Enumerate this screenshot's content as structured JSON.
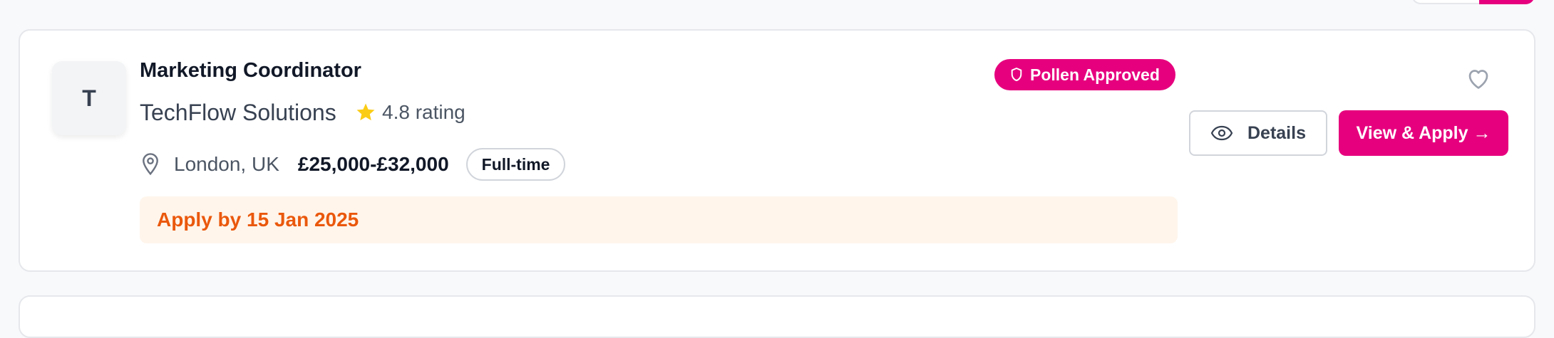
{
  "job": {
    "logo_letter": "T",
    "title": "Marketing Coordinator",
    "company": "TechFlow Solutions",
    "rating": "4.8 rating",
    "location": "London, UK",
    "salary": "£25,000-£32,000",
    "employment_type": "Full-time",
    "deadline": "Apply by 15 Jan 2025",
    "badge": "Pollen Approved"
  },
  "actions": {
    "details_label": "Details",
    "apply_label": "View & Apply →"
  },
  "icons": {
    "star": "star-icon",
    "location": "map-pin-icon",
    "badge": "shield-icon",
    "favorite": "heart-icon",
    "details": "eye-icon"
  },
  "colors": {
    "brand": "#e6007e",
    "star": "#facc15",
    "deadline_text": "#ea580c",
    "deadline_bg": "#fff5eb"
  }
}
